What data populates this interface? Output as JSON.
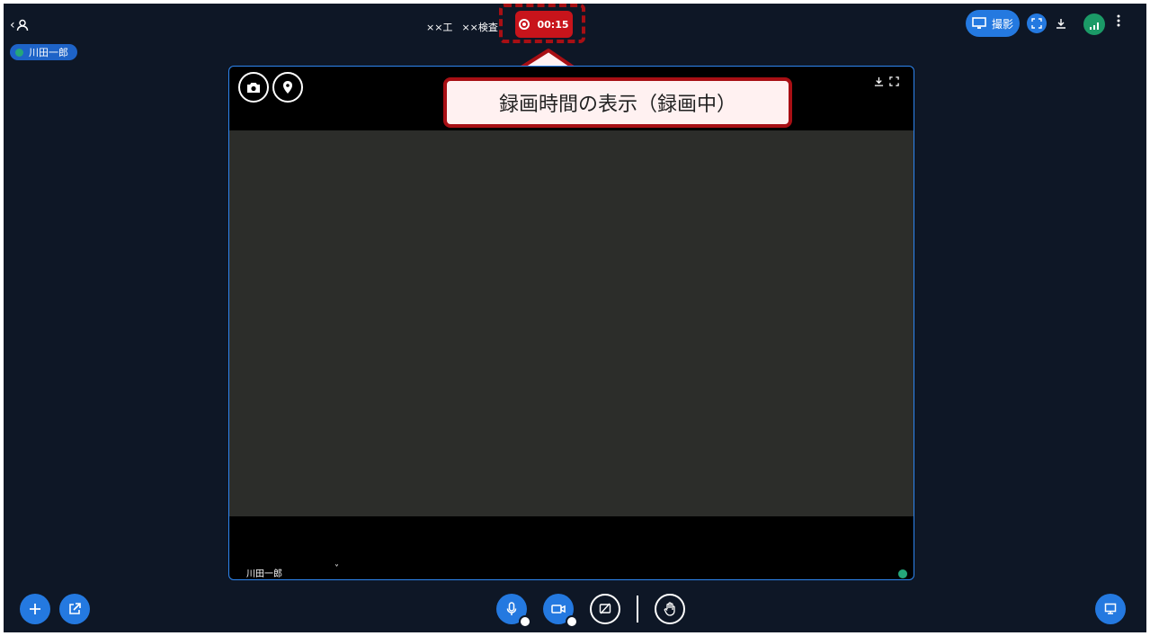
{
  "header": {
    "back_user_glyph": "‹",
    "participant_name": "川田一郎",
    "label_work": "××工",
    "label_inspection": "××検査",
    "recording_time": "00:15",
    "camera_mode_label": "撮影"
  },
  "video": {
    "participant_name": "川田一郎",
    "chevron": "˅"
  },
  "annotation": {
    "callout_text": "録画時間の表示（録画中）"
  },
  "colors": {
    "accent_blue": "#2479e0",
    "recording_red": "#c8141b",
    "annotation_red": "#a80f14",
    "background": "#0e1726",
    "signal_green": "#1b9a67"
  },
  "icons": {
    "back": "chevron-left-icon",
    "user": "user-icon",
    "record": "record-icon",
    "monitor": "monitor-icon",
    "fullscreen": "fullscreen-icon",
    "download": "download-icon",
    "signal": "signal-icon",
    "more": "more-vertical-icon",
    "camera": "camera-icon",
    "location": "location-pin-icon",
    "add": "plus-icon",
    "external": "external-link-icon",
    "mic": "microphone-icon",
    "video": "video-camera-icon",
    "screen_off": "screen-share-off-icon",
    "hand": "raise-hand-icon",
    "whiteboard": "whiteboard-icon"
  }
}
